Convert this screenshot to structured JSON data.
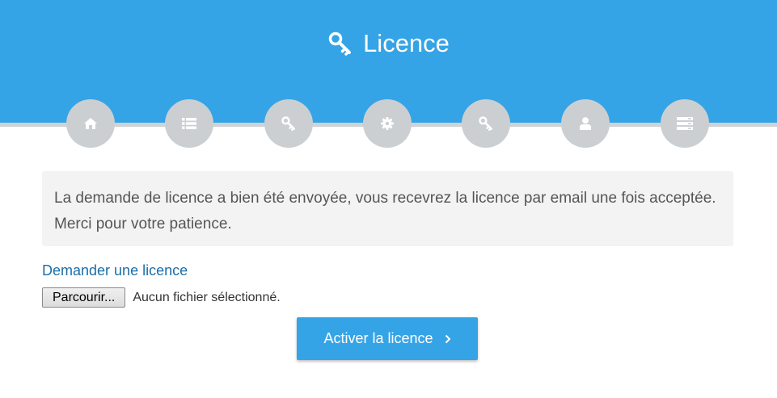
{
  "header": {
    "title": "Licence",
    "icon": "key-icon",
    "background_color": "#35a4e6"
  },
  "steps": [
    {
      "name": "home",
      "icon": "home-icon"
    },
    {
      "name": "list",
      "icon": "list-icon"
    },
    {
      "name": "key",
      "icon": "key-icon"
    },
    {
      "name": "settings",
      "icon": "gear-icon"
    },
    {
      "name": "licence",
      "icon": "key-icon"
    },
    {
      "name": "user",
      "icon": "user-icon"
    },
    {
      "name": "server",
      "icon": "server-icon"
    }
  ],
  "alert": {
    "message": "La demande de licence a bien été envoyée, vous recevrez la licence par email une fois acceptée. Merci pour votre patience."
  },
  "request_link": {
    "label": "Demander une licence"
  },
  "file_input": {
    "button_label": "Parcourir...",
    "status": "Aucun fichier sélectionné."
  },
  "activate_button": {
    "label": "Activer la licence",
    "icon": "chevron-right-icon"
  },
  "colors": {
    "accent": "#35a4e6",
    "step_inactive": "#cbcfd2",
    "link": "#1a6ea8"
  }
}
